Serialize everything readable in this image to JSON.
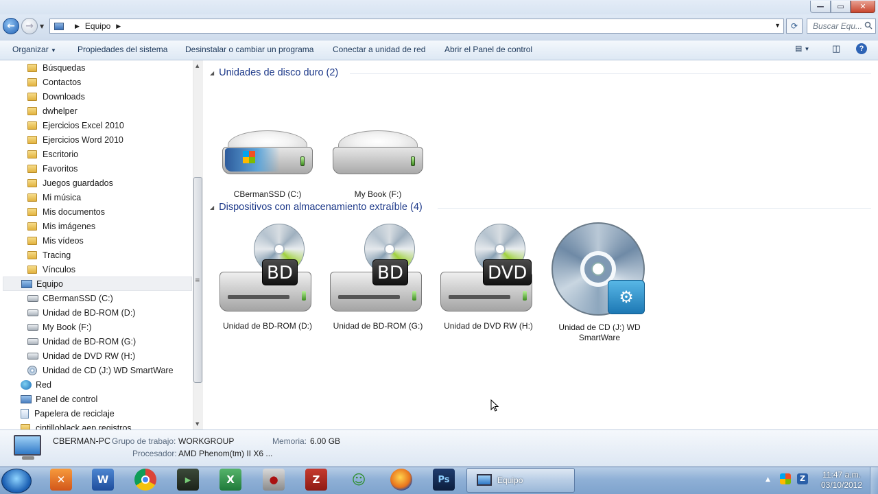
{
  "window": {
    "min": "—",
    "max": "▭",
    "close": "✕"
  },
  "nav": {
    "back": "←",
    "forward": "→"
  },
  "address": {
    "crumb": "Equipo",
    "search_placeholder": "Buscar Equ..."
  },
  "toolbar": {
    "organize": "Organizar",
    "system_properties": "Propiedades del sistema",
    "uninstall": "Desinstalar o cambiar un programa",
    "map_drive": "Conectar a unidad de red",
    "control_panel": "Abrir el Panel de control"
  },
  "sidebar": {
    "items": [
      {
        "label": "Búsquedas",
        "icon": "folder-icon"
      },
      {
        "label": "Contactos",
        "icon": "folder-icon"
      },
      {
        "label": "Downloads",
        "icon": "folder-icon"
      },
      {
        "label": "dwhelper",
        "icon": "folder-icon"
      },
      {
        "label": "Ejercicios Excel 2010",
        "icon": "folder-icon"
      },
      {
        "label": "Ejercicios Word 2010",
        "icon": "folder-icon"
      },
      {
        "label": "Escritorio",
        "icon": "folder-icon"
      },
      {
        "label": "Favoritos",
        "icon": "folder-icon"
      },
      {
        "label": "Juegos guardados",
        "icon": "folder-icon"
      },
      {
        "label": "Mi música",
        "icon": "folder-icon"
      },
      {
        "label": "Mis documentos",
        "icon": "folder-icon"
      },
      {
        "label": "Mis imágenes",
        "icon": "folder-icon"
      },
      {
        "label": "Mis vídeos",
        "icon": "folder-icon"
      },
      {
        "label": "Tracing",
        "icon": "folder-icon"
      },
      {
        "label": "Vínculos",
        "icon": "folder-icon"
      },
      {
        "label": "Equipo",
        "icon": "computer-icon"
      },
      {
        "label": "CBermanSSD (C:)",
        "icon": "drive-icon"
      },
      {
        "label": "Unidad de BD-ROM (D:)",
        "icon": "drive-icon"
      },
      {
        "label": "My Book (F:)",
        "icon": "drive-icon"
      },
      {
        "label": "Unidad de BD-ROM (G:)",
        "icon": "drive-icon"
      },
      {
        "label": "Unidad de DVD RW (H:)",
        "icon": "drive-icon"
      },
      {
        "label": "Unidad de CD (J:) WD SmartWare",
        "icon": "cd-icon"
      },
      {
        "label": "Red",
        "icon": "network-icon"
      },
      {
        "label": "Panel de control",
        "icon": "control-panel-icon"
      },
      {
        "label": "Papelera de reciclaje",
        "icon": "recycle-bin-icon"
      },
      {
        "label": "cintilloblack.aep registros",
        "icon": "folder-icon"
      }
    ]
  },
  "groups": {
    "hdd": {
      "title": "Unidades de disco duro (2)"
    },
    "removable": {
      "title": "Dispositivos con almacenamiento extraíble (4)"
    }
  },
  "drives": {
    "c": {
      "label": "CBermanSSD (C:)"
    },
    "f": {
      "label": "My Book (F:)"
    },
    "d": {
      "label": "Unidad de BD-ROM (D:)",
      "badge": "BD"
    },
    "g": {
      "label": "Unidad de BD-ROM (G:)",
      "badge": "BD"
    },
    "h": {
      "label": "Unidad de DVD RW (H:)",
      "badge": "DVD"
    },
    "j": {
      "label_line1": "Unidad de CD (J:) WD",
      "label_line2": "SmartWare"
    }
  },
  "details": {
    "pc_name": "CBERMAN-PC",
    "workgroup_key": "Grupo de trabajo:",
    "workgroup_val": "WORKGROUP",
    "memory_key": "Memoria:",
    "memory_val": "6.00 GB",
    "cpu_key": "Procesador:",
    "cpu_val": "AMD Phenom(tm) II X6 ..."
  },
  "taskbar": {
    "active_window": "Equipo",
    "time": "11:47 a.m.",
    "date": "03/10/2012",
    "apps": [
      "xampp-icon",
      "word-icon",
      "chrome-icon",
      "cmd-icon",
      "excel-icon",
      "app-icon",
      "filezilla-icon",
      "messenger-icon",
      "firefox-icon",
      "photoshop-icon"
    ]
  },
  "colors": {
    "accent": "#1e3a8a",
    "taskbar": "#8fb0d6"
  }
}
